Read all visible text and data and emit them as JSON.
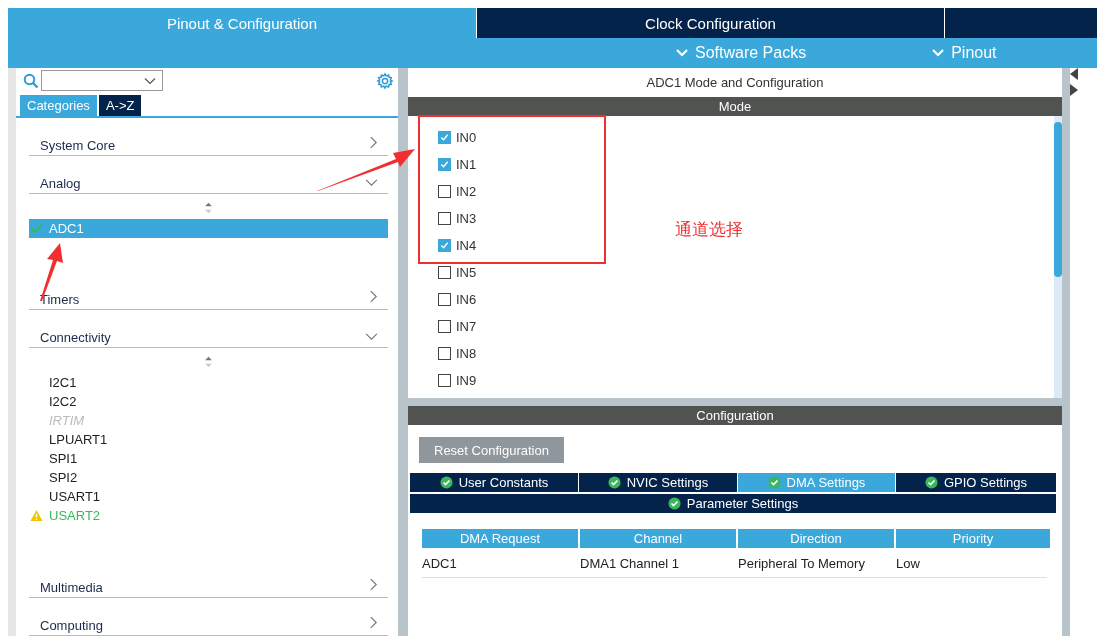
{
  "tabs": [
    {
      "label": "Pinout & Configuration",
      "selected": true
    },
    {
      "label": "Clock Configuration",
      "selected": false
    }
  ],
  "menus": [
    "Software Packs",
    "Pinout"
  ],
  "sidebar": {
    "view_tabs": [
      {
        "label": "Categories",
        "selected": true
      },
      {
        "label": "A->Z",
        "selected": false
      }
    ],
    "categories": [
      {
        "label": "System Core",
        "expanded": false
      },
      {
        "label": "Analog",
        "expanded": true,
        "children": [
          {
            "label": "ADC1",
            "selected": true,
            "configured": true,
            "warning": false,
            "disabled": false
          }
        ]
      },
      {
        "label": "Timers",
        "expanded": false
      },
      {
        "label": "Connectivity",
        "expanded": true,
        "children": [
          {
            "label": "I2C1",
            "selected": false,
            "configured": false,
            "warning": false,
            "disabled": false
          },
          {
            "label": "I2C2",
            "selected": false,
            "configured": false,
            "warning": false,
            "disabled": false
          },
          {
            "label": "IRTIM",
            "selected": false,
            "configured": false,
            "warning": false,
            "disabled": true
          },
          {
            "label": "LPUART1",
            "selected": false,
            "configured": false,
            "warning": false,
            "disabled": false
          },
          {
            "label": "SPI1",
            "selected": false,
            "configured": false,
            "warning": false,
            "disabled": false
          },
          {
            "label": "SPI2",
            "selected": false,
            "configured": false,
            "warning": false,
            "disabled": false
          },
          {
            "label": "USART1",
            "selected": false,
            "configured": false,
            "warning": false,
            "disabled": false
          },
          {
            "label": "USART2",
            "selected": false,
            "configured": false,
            "warning": true,
            "disabled": false
          }
        ]
      },
      {
        "label": "Multimedia",
        "expanded": false
      },
      {
        "label": "Computing",
        "expanded": false
      }
    ]
  },
  "panel_title": "ADC1 Mode and Configuration",
  "mode": {
    "title": "Mode",
    "channels": [
      {
        "label": "IN0",
        "checked": true
      },
      {
        "label": "IN1",
        "checked": true
      },
      {
        "label": "IN2",
        "checked": false
      },
      {
        "label": "IN3",
        "checked": false
      },
      {
        "label": "IN4",
        "checked": true
      },
      {
        "label": "IN5",
        "checked": false
      },
      {
        "label": "IN6",
        "checked": false
      },
      {
        "label": "IN7",
        "checked": false
      },
      {
        "label": "IN8",
        "checked": false
      },
      {
        "label": "IN9",
        "checked": false
      }
    ]
  },
  "configuration": {
    "title": "Configuration",
    "reset_button": "Reset Configuration",
    "tabs": [
      {
        "label": "User Constants",
        "selected": false
      },
      {
        "label": "NVIC Settings",
        "selected": false
      },
      {
        "label": "DMA Settings",
        "selected": true
      },
      {
        "label": "GPIO Settings",
        "selected": false
      },
      {
        "label": "Parameter Settings",
        "selected": false
      }
    ],
    "table": {
      "columns": [
        "DMA Request",
        "Channel",
        "Direction",
        "Priority"
      ],
      "rows": [
        [
          "ADC1",
          "DMA1 Channel 1",
          "Peripheral To Memory",
          "Low"
        ]
      ]
    }
  },
  "annotation": {
    "note": "通道选择"
  }
}
